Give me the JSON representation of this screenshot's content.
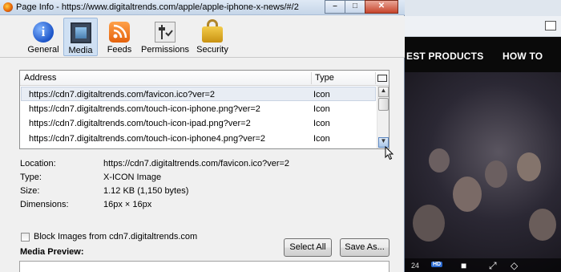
{
  "window": {
    "title": "Page Info - https://www.digitaltrends.com/apple/apple-iphone-x-news/#/2"
  },
  "toolbar": {
    "tabs": [
      {
        "label": "General",
        "icon": "info-icon"
      },
      {
        "label": "Media",
        "icon": "media-icon",
        "active": true
      },
      {
        "label": "Feeds",
        "icon": "rss-icon"
      },
      {
        "label": "Permissions",
        "icon": "permissions-icon"
      },
      {
        "label": "Security",
        "icon": "lock-icon"
      }
    ]
  },
  "media_table": {
    "columns": [
      "Address",
      "Type"
    ],
    "rows": [
      {
        "address": "https://cdn7.digitaltrends.com/favicon.ico?ver=2",
        "type": "Icon"
      },
      {
        "address": "https://cdn7.digitaltrends.com/touch-icon-iphone.png?ver=2",
        "type": "Icon"
      },
      {
        "address": "https://cdn7.digitaltrends.com/touch-icon-ipad.png?ver=2",
        "type": "Icon"
      },
      {
        "address": "https://cdn7.digitaltrends.com/touch-icon-iphone4.png?ver=2",
        "type": "Icon"
      }
    ]
  },
  "details": {
    "location_label": "Location:",
    "location_value": "https://cdn7.digitaltrends.com/favicon.ico?ver=2",
    "type_label": "Type:",
    "type_value": "X-ICON Image",
    "size_label": "Size:",
    "size_value": "1.12 KB (1,150 bytes)",
    "dimensions_label": "Dimensions:",
    "dimensions_value": "16px × 16px"
  },
  "block_images": {
    "label": "Block Images from cdn7.digitaltrends.com",
    "checked": false
  },
  "buttons": {
    "select_all": "Select All",
    "save_as": "Save As..."
  },
  "media_preview": {
    "label": "Media Preview:"
  },
  "background_page": {
    "nav_items": [
      "EST PRODUCTS",
      "HOW TO"
    ],
    "video_time": "24",
    "hd_badge": "HD"
  }
}
